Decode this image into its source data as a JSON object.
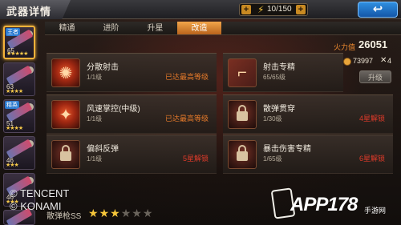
{
  "header": {
    "title": "武器详情",
    "energy_text": "10/150",
    "back_label": "↩"
  },
  "weapons": [
    {
      "tag": "王者",
      "level": "65",
      "stars": "★★★★★"
    },
    {
      "tag": "",
      "level": "63",
      "stars": "★★★★"
    },
    {
      "tag": "精英",
      "level": "51",
      "stars": "★★★★"
    },
    {
      "tag": "",
      "level": "46",
      "stars": "★★★"
    },
    {
      "tag": "",
      "level": "46",
      "stars": "★★★"
    },
    {
      "tag": "",
      "level": "",
      "stars": ""
    }
  ],
  "tabs": [
    {
      "label": "精通"
    },
    {
      "label": "进阶"
    },
    {
      "label": "升星"
    },
    {
      "label": "改造"
    }
  ],
  "power": {
    "label": "火力值",
    "value": "26051"
  },
  "skills": [
    {
      "name": "分散射击",
      "level": "1/1级",
      "status": "已达最高等级",
      "icon": "scatter-fire-icon"
    },
    {
      "name": "射击专精",
      "level": "65/65级",
      "status": "",
      "icon": "rifle-icon"
    },
    {
      "name": "风速掌控(中级)",
      "level": "1/1级",
      "status": "已达最高等级",
      "icon": "wind-control-icon"
    },
    {
      "name": "散弹贯穿",
      "level": "1/30级",
      "status": "4星解锁",
      "icon": "lock-icon"
    },
    {
      "name": "偏斜反弹",
      "level": "1/1级",
      "status": "5星解锁",
      "icon": "lock-icon"
    },
    {
      "name": "暴击伤害专精",
      "level": "1/65级",
      "status": "6星解锁",
      "icon": "lock-icon"
    }
  ],
  "cost": {
    "coins": "73997",
    "count": "4"
  },
  "upgrade_label": "升级",
  "footer": {
    "copyright_line1": "© TENCENT",
    "copyright_line2": "© KONAMI",
    "weapon_name": "散弹枪SS",
    "stars_filled": 3,
    "stars_total": 6
  },
  "watermark": {
    "brand": "APP178",
    "sub": "手游网"
  },
  "colors": {
    "accent": "#f2a54a",
    "max": "#e67a2a",
    "locked": "#e13b2a"
  }
}
